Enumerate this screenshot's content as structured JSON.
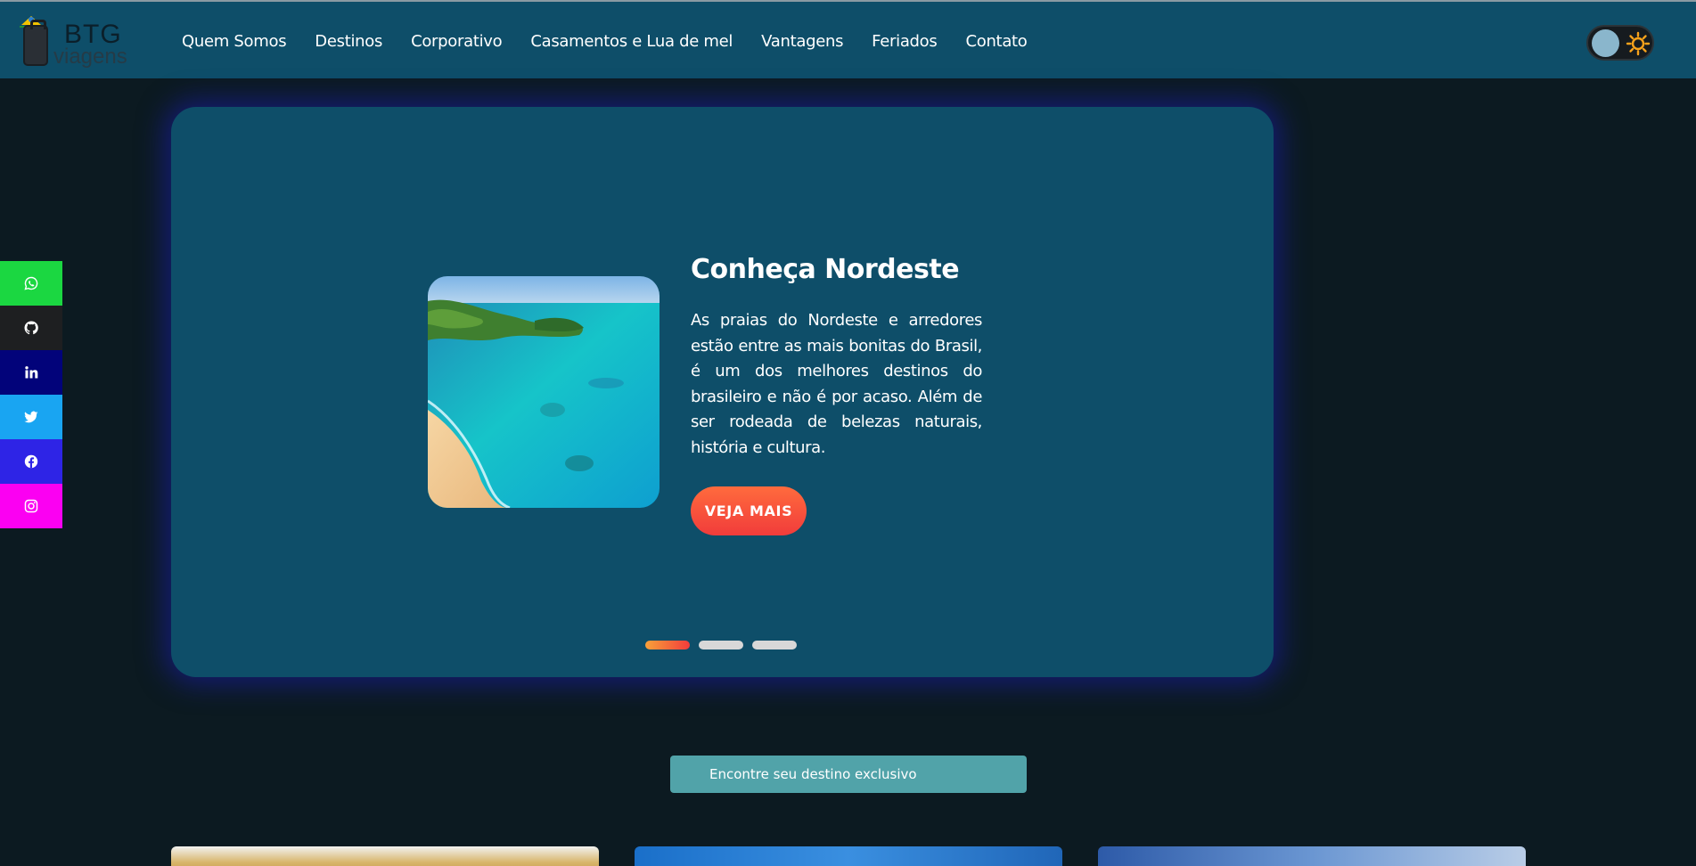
{
  "brand": {
    "line1": "BTG",
    "line2": "viagens"
  },
  "nav": [
    {
      "label": "Quem Somos"
    },
    {
      "label": "Destinos"
    },
    {
      "label": "Corporativo"
    },
    {
      "label": "Casamentos e Lua de mel"
    },
    {
      "label": "Vantagens"
    },
    {
      "label": "Feriados"
    },
    {
      "label": "Contato"
    }
  ],
  "theme_toggle": {
    "state": "light",
    "icon": "sun-icon"
  },
  "social": [
    {
      "name": "whatsapp",
      "color": "#1bd741"
    },
    {
      "name": "github",
      "color": "#1e1f21"
    },
    {
      "name": "linkedin",
      "color": "#02037a"
    },
    {
      "name": "twitter",
      "color": "#19a5f2"
    },
    {
      "name": "facebook",
      "color": "#2e24e6"
    },
    {
      "name": "instagram",
      "color": "#fb00f2"
    }
  ],
  "hero": {
    "title": "Conheça Nordeste",
    "text": "As praias do Nordeste e arredores estão entre as mais bonitas do Brasil, é um dos melhores destinos do brasileiro e não é por acaso. Além de ser rodeada de belezas naturais, história e cultura.",
    "button": "VEJA MAIS",
    "slides": 3,
    "active_slide": 1
  },
  "cta": {
    "label": "Encontre seu destino exclusivo"
  },
  "colors": {
    "header": "#0e4e69",
    "background": "#0c1a21",
    "accent": "#f13c3b",
    "cta": "#51a3a9"
  }
}
